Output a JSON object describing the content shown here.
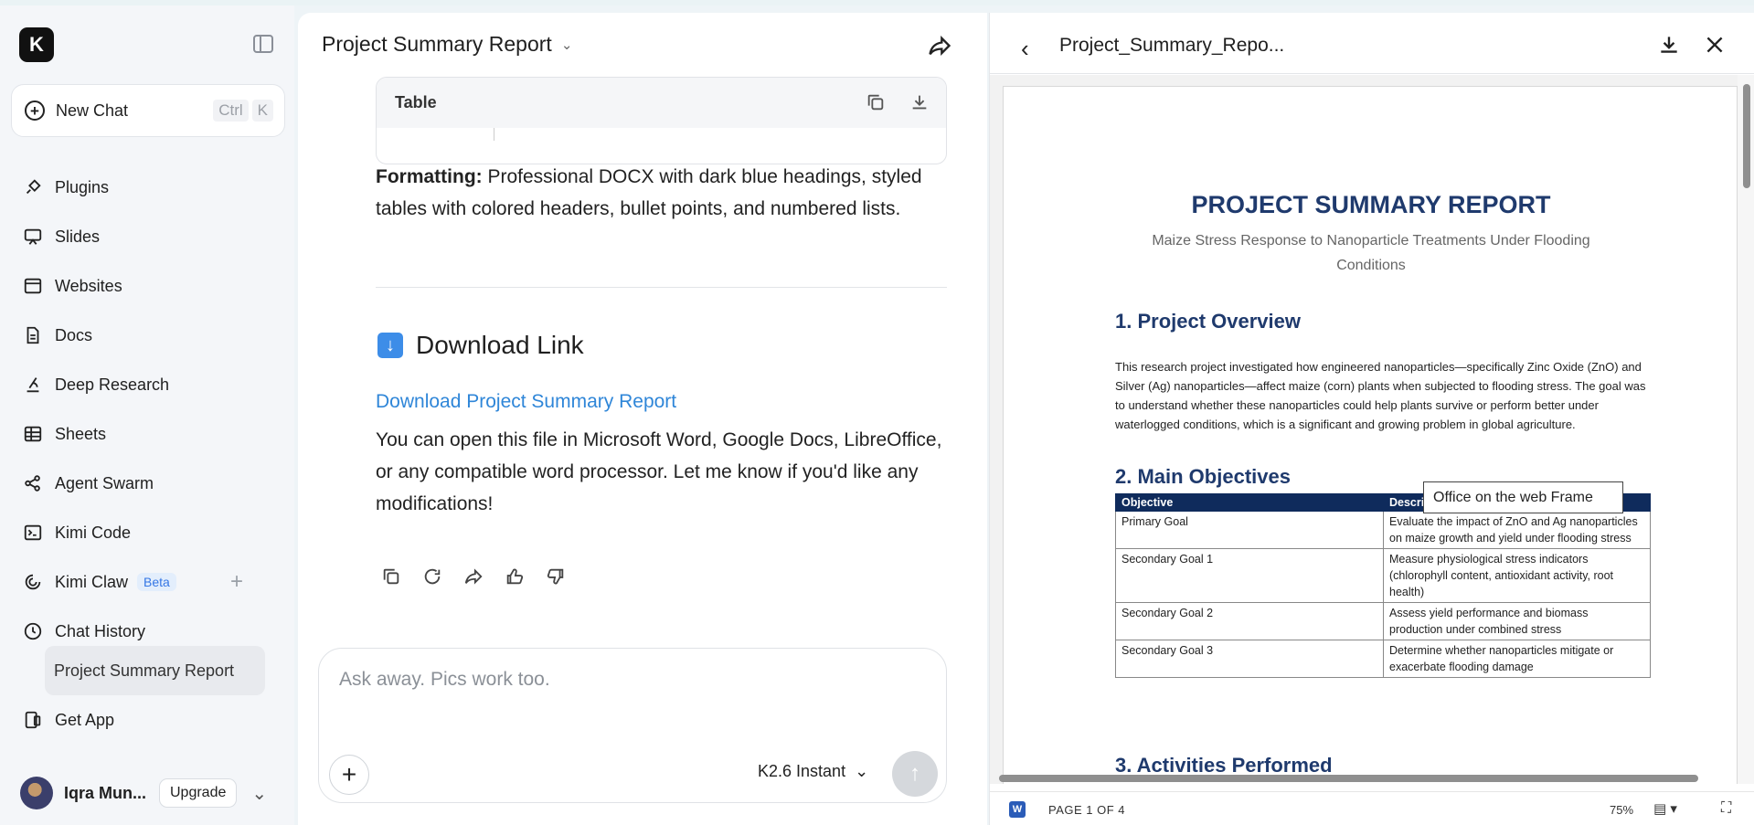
{
  "sidebar": {
    "logo": "K",
    "new_chat": {
      "label": "New Chat",
      "shortcut_keys": [
        "Ctrl",
        "K"
      ]
    },
    "items": [
      {
        "label": "Plugins",
        "icon": "plugin-icon"
      },
      {
        "label": "Slides",
        "icon": "slides-icon"
      },
      {
        "label": "Websites",
        "icon": "website-icon"
      },
      {
        "label": "Docs",
        "icon": "document-icon"
      },
      {
        "label": "Deep Research",
        "icon": "research-icon"
      },
      {
        "label": "Sheets",
        "icon": "sheet-icon"
      },
      {
        "label": "Agent Swarm",
        "icon": "swarm-icon"
      },
      {
        "label": "Kimi Code",
        "icon": "terminal-icon"
      },
      {
        "label": "Kimi Claw",
        "icon": "claw-icon",
        "badge": "Beta"
      },
      {
        "label": "Chat History",
        "icon": "clock-icon"
      }
    ],
    "history": [
      "Project Summary Report"
    ],
    "get_app": "Get App",
    "user": {
      "name": "Iqra Mun...",
      "upgrade": "Upgrade"
    }
  },
  "chat": {
    "title": "Project Summary Report",
    "table_card": {
      "label": "Table"
    },
    "formatting": {
      "bold": "Formatting:",
      "text": " Professional DOCX with dark blue headings, styled tables with colored headers, bullet points, and numbered lists."
    },
    "download_heading": "Download Link",
    "download_link": "Download Project Summary Report",
    "closing": "You can open this file in Microsoft Word, Google Docs, LibreOffice, or any compatible word processor. Let me know if you'd like any modifications!",
    "input": {
      "placeholder": "Ask away. Pics work too.",
      "model": "K2.6 Instant"
    }
  },
  "preview": {
    "filename": "Project_Summary_Repo...",
    "doc": {
      "title": "PROJECT SUMMARY REPORT",
      "subtitle": "Maize Stress Response to Nanoparticle Treatments Under Flooding Conditions",
      "h1": "1. Project Overview",
      "overview": "This research project investigated how engineered nanoparticles—specifically Zinc Oxide (ZnO) and Silver (Ag) nanoparticles—affect maize (corn) plants when subjected to flooding stress. The goal was to understand whether these nanoparticles could help plants survive or perform better under waterlogged conditions, which is a significant and growing problem in global agriculture.",
      "h2": "2. Main Objectives",
      "table_headers": [
        "Objective",
        "Descri"
      ],
      "table_rows": [
        [
          "Primary Goal",
          "Evaluate the impact of ZnO and Ag nanoparticles on maize growth and yield under flooding stress"
        ],
        [
          "Secondary Goal 1",
          "Measure physiological stress indicators (chlorophyll content, antioxidant activity, root health)"
        ],
        [
          "Secondary Goal 2",
          "Assess yield performance and biomass production under combined stress"
        ],
        [
          "Secondary Goal 3",
          "Determine whether nanoparticles mitigate or exacerbate flooding damage"
        ]
      ],
      "h3": "3. Activities Performed",
      "tooltip": "Office on the web Frame"
    },
    "status": {
      "word_badge": "W",
      "page": "PAGE 1 OF 4",
      "zoom": "75%"
    }
  }
}
